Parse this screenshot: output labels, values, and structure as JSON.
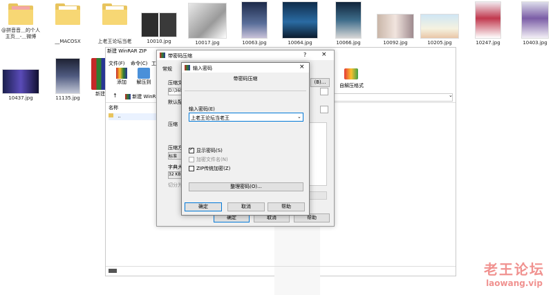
{
  "desktop_icons": [
    {
      "label": "@拼音音＿的个人主页＿-＿微博",
      "kind": "folder"
    },
    {
      "label": "__MACOSX",
      "kind": "folder"
    },
    {
      "label": "上老王论坛当老",
      "kind": "folder"
    },
    {
      "label": "10010.jpg",
      "kind": "image"
    },
    {
      "label": "10017.jpg",
      "kind": "image"
    },
    {
      "label": "10063.jpg",
      "kind": "image"
    },
    {
      "label": "10064.jpg",
      "kind": "image"
    },
    {
      "label": "10066.jpg",
      "kind": "image"
    },
    {
      "label": "10092.jpg",
      "kind": "image"
    },
    {
      "label": "10205.jpg",
      "kind": "image"
    },
    {
      "label": "10247.jpg",
      "kind": "image"
    },
    {
      "label": "10403.jpg",
      "kind": "image"
    },
    {
      "label": "10437.jpg",
      "kind": "image"
    },
    {
      "label": "11135.jpg",
      "kind": "image"
    },
    {
      "label": "新建 ZIP 压",
      "kind": "archive"
    }
  ],
  "explorer": {
    "tab_label": "新建 WinR",
    "column_name": "名称",
    "row_parent": "..",
    "extract_format_label": "自解压格式"
  },
  "rar_window": {
    "title": "带密码压缩",
    "menu": [
      "文件(F)",
      "命令(C)",
      "工"
    ],
    "title_prefix": "新建 WinRAR ZIP",
    "tab_general": "常规",
    "toolbar": {
      "add": "添加",
      "extract": "解压到"
    },
    "archive_name_label": "压缩文",
    "path_value": "D:\\360",
    "default_label": "默认配",
    "compress_label": "压缩",
    "compress_method_label": "压缩方",
    "compress_method_value": "标准",
    "dict_label": "字典大",
    "dict_value": "32 KB",
    "split_label": "切分为",
    "btn_browse": "(B)...",
    "btn_ok": "确定",
    "btn_cancel": "取消",
    "btn_help": "帮助"
  },
  "dialog": {
    "title": "输入密码",
    "heading": "带密码压缩",
    "password_label": "输入密码(E)",
    "password_value": "上老王论坛当老王",
    "show_password": "显示密码(S)",
    "show_password_checked": true,
    "encrypt_names": "加密文件名(N)",
    "encrypt_names_checked": false,
    "zip_legacy": "ZIP传统加密(Z)",
    "zip_legacy_checked": false,
    "organize_btn": "整理密码(O)...",
    "btn_ok": "确定",
    "btn_cancel": "取消",
    "btn_help": "帮助"
  },
  "watermark": {
    "line1": "老王论坛",
    "line2": "laowang.vip"
  },
  "colors": {
    "accent": "#0078d7",
    "folder": "#f7d774",
    "watermark": "#e53935"
  }
}
